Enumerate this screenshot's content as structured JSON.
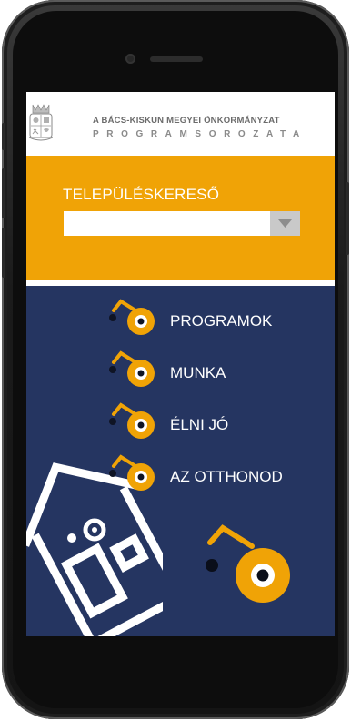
{
  "header": {
    "title_line1": "A BÁCS-KISKUN MEGYEI ÖNKORMÁNYZAT",
    "title_line2": "PROGRAMSOROZATA"
  },
  "search": {
    "label": "TELEPÜLÉSKERESŐ",
    "selected_value": ""
  },
  "menu": {
    "items": [
      {
        "label": "PROGRAMOK"
      },
      {
        "label": "MUNKA"
      },
      {
        "label": "ÉLNI JÓ"
      },
      {
        "label": "AZ OTTHONOD"
      }
    ]
  },
  "colors": {
    "accent_orange": "#f0a306",
    "navy": "#253561",
    "white": "#ffffff"
  },
  "icons": {
    "menu_item_icon": "eye-key-icon",
    "dropdown_arrow": "chevron-down-icon",
    "crest": "coat-of-arms-icon",
    "house": "house-illustration-icon"
  }
}
